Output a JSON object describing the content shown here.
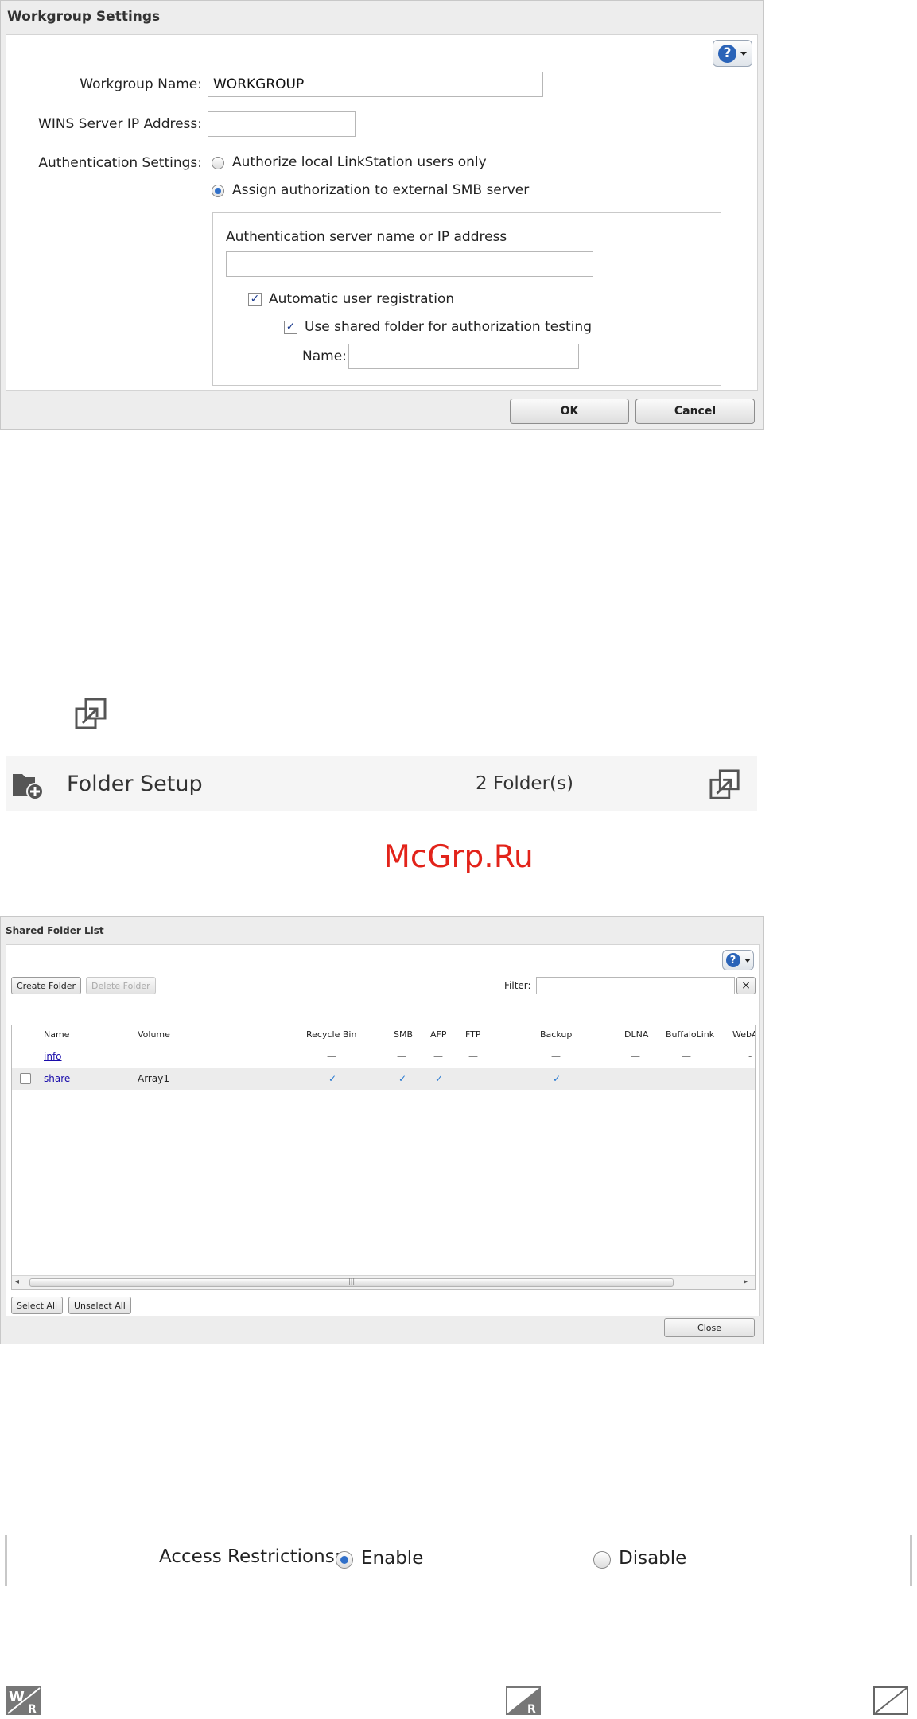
{
  "workgroup_dialog": {
    "title": "Workgroup Settings",
    "workgroup_name_label": "Workgroup Name:",
    "workgroup_name_value": "WORKGROUP",
    "wins_label": "WINS Server IP Address:",
    "wins_value": "",
    "auth_label": "Authentication Settings:",
    "auth_option_local": "Authorize local LinkStation users only",
    "auth_option_external": "Assign authorization to external SMB server",
    "auth_selected": "external",
    "auth_server_label": "Authentication server name or IP address",
    "auth_server_value": "",
    "auto_registration_label": "Automatic user registration",
    "auto_registration_checked": true,
    "shared_folder_test_label": "Use shared folder for authorization testing",
    "shared_folder_test_checked": true,
    "name_label": "Name:",
    "name_value": "",
    "ok_label": "OK",
    "cancel_label": "Cancel"
  },
  "folder_setup": {
    "title": "Folder Setup",
    "count": "2 Folder(s)"
  },
  "watermark": "McGrp.Ru",
  "shared_folder_list": {
    "title": "Shared Folder List",
    "create_label": "Create Folder",
    "delete_label": "Delete Folder",
    "filter_label": "Filter:",
    "filter_value": "",
    "columns": [
      "Name",
      "Volume",
      "Recycle Bin",
      "SMB",
      "AFP",
      "FTP",
      "Backup",
      "DLNA",
      "BuffaloLink",
      "WebA"
    ],
    "rows": [
      {
        "name": "info",
        "volume": "",
        "recycle": "—",
        "smb": "—",
        "afp": "—",
        "ftp": "—",
        "backup": "—",
        "dlna": "—",
        "buffalolink": "—",
        "weba": "-"
      },
      {
        "name": "share",
        "volume": "Array1",
        "recycle": "✓",
        "smb": "✓",
        "afp": "✓",
        "ftp": "—",
        "backup": "✓",
        "dlna": "—",
        "buffalolink": "—",
        "weba": "-"
      }
    ],
    "select_all_label": "Select All",
    "unselect_all_label": "Unselect All",
    "close_label": "Close"
  },
  "access_restrictions": {
    "label": "Access Restrictions:",
    "enable_label": "Enable",
    "disable_label": "Disable",
    "selected": "enable"
  },
  "permission_icons": {
    "read_write_letters": "W R",
    "read_only_letter": "R"
  }
}
